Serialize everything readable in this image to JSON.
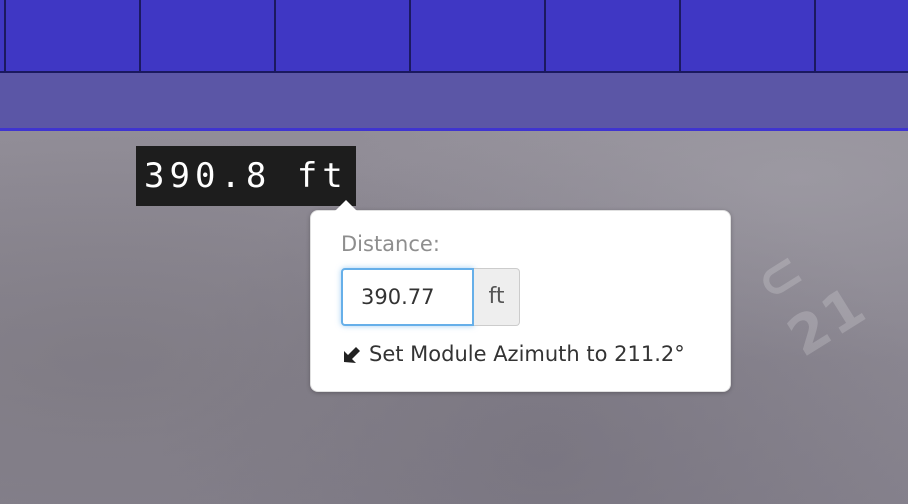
{
  "measurement": {
    "label": "390.8 ft"
  },
  "popover": {
    "field_label": "Distance:",
    "distance_value": "390.77",
    "unit": "ft",
    "azimuth_action": "Set Module Azimuth to 211.2°",
    "azimuth_icon": "arrow-down-left-icon"
  },
  "colors": {
    "module_fill": "#3f37c4",
    "module_edge": "#1b1960",
    "band_fill": "#5b56a6",
    "band_edge": "#3f34d0",
    "input_focus": "#66afe9"
  }
}
